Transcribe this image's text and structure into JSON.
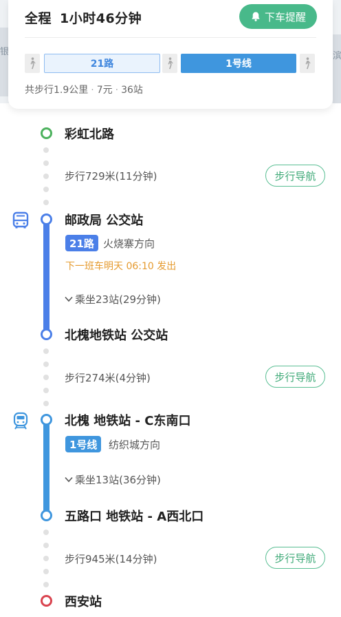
{
  "map": {
    "left_fragment": "银",
    "right_fragment": "滨"
  },
  "summary": {
    "total_label": "全程",
    "total_time": "1小时46分钟",
    "alert_button": "下车提醒",
    "segments": {
      "bus": "21路",
      "metro": "1号线"
    },
    "meta": {
      "walk": "共步行1.9公里",
      "price": "7元",
      "stops": "36站",
      "separator": "·"
    }
  },
  "route": {
    "start": "彩虹北路",
    "walk1": "步行729米(11分钟)",
    "walk_nav_label": "步行导航",
    "bus": {
      "board_stop": "邮政局 公交站",
      "line": "21路",
      "direction": "火烧寨方向",
      "next_departure": "下一班车明天 06:10 发出",
      "ride": "乘坐23站(29分钟)",
      "alight_stop": "北槐地铁站 公交站"
    },
    "walk2": "步行274米(4分钟)",
    "metro": {
      "board_stop": "北槐 地铁站 - C东南口",
      "line": "1号线",
      "direction": "纺织城方向",
      "ride": "乘坐13站(36分钟)",
      "alight_stop": "五路口 地铁站 - A西北口"
    },
    "walk3": "步行945米(14分钟)",
    "end": "西安站"
  },
  "colors": {
    "accent_green": "#48b98a",
    "bus_blue": "#4b7fe8",
    "metro_blue": "#3f96de",
    "orange_notice": "#e59a2e",
    "start_green": "#4cb15d",
    "end_red": "#d9434e"
  }
}
